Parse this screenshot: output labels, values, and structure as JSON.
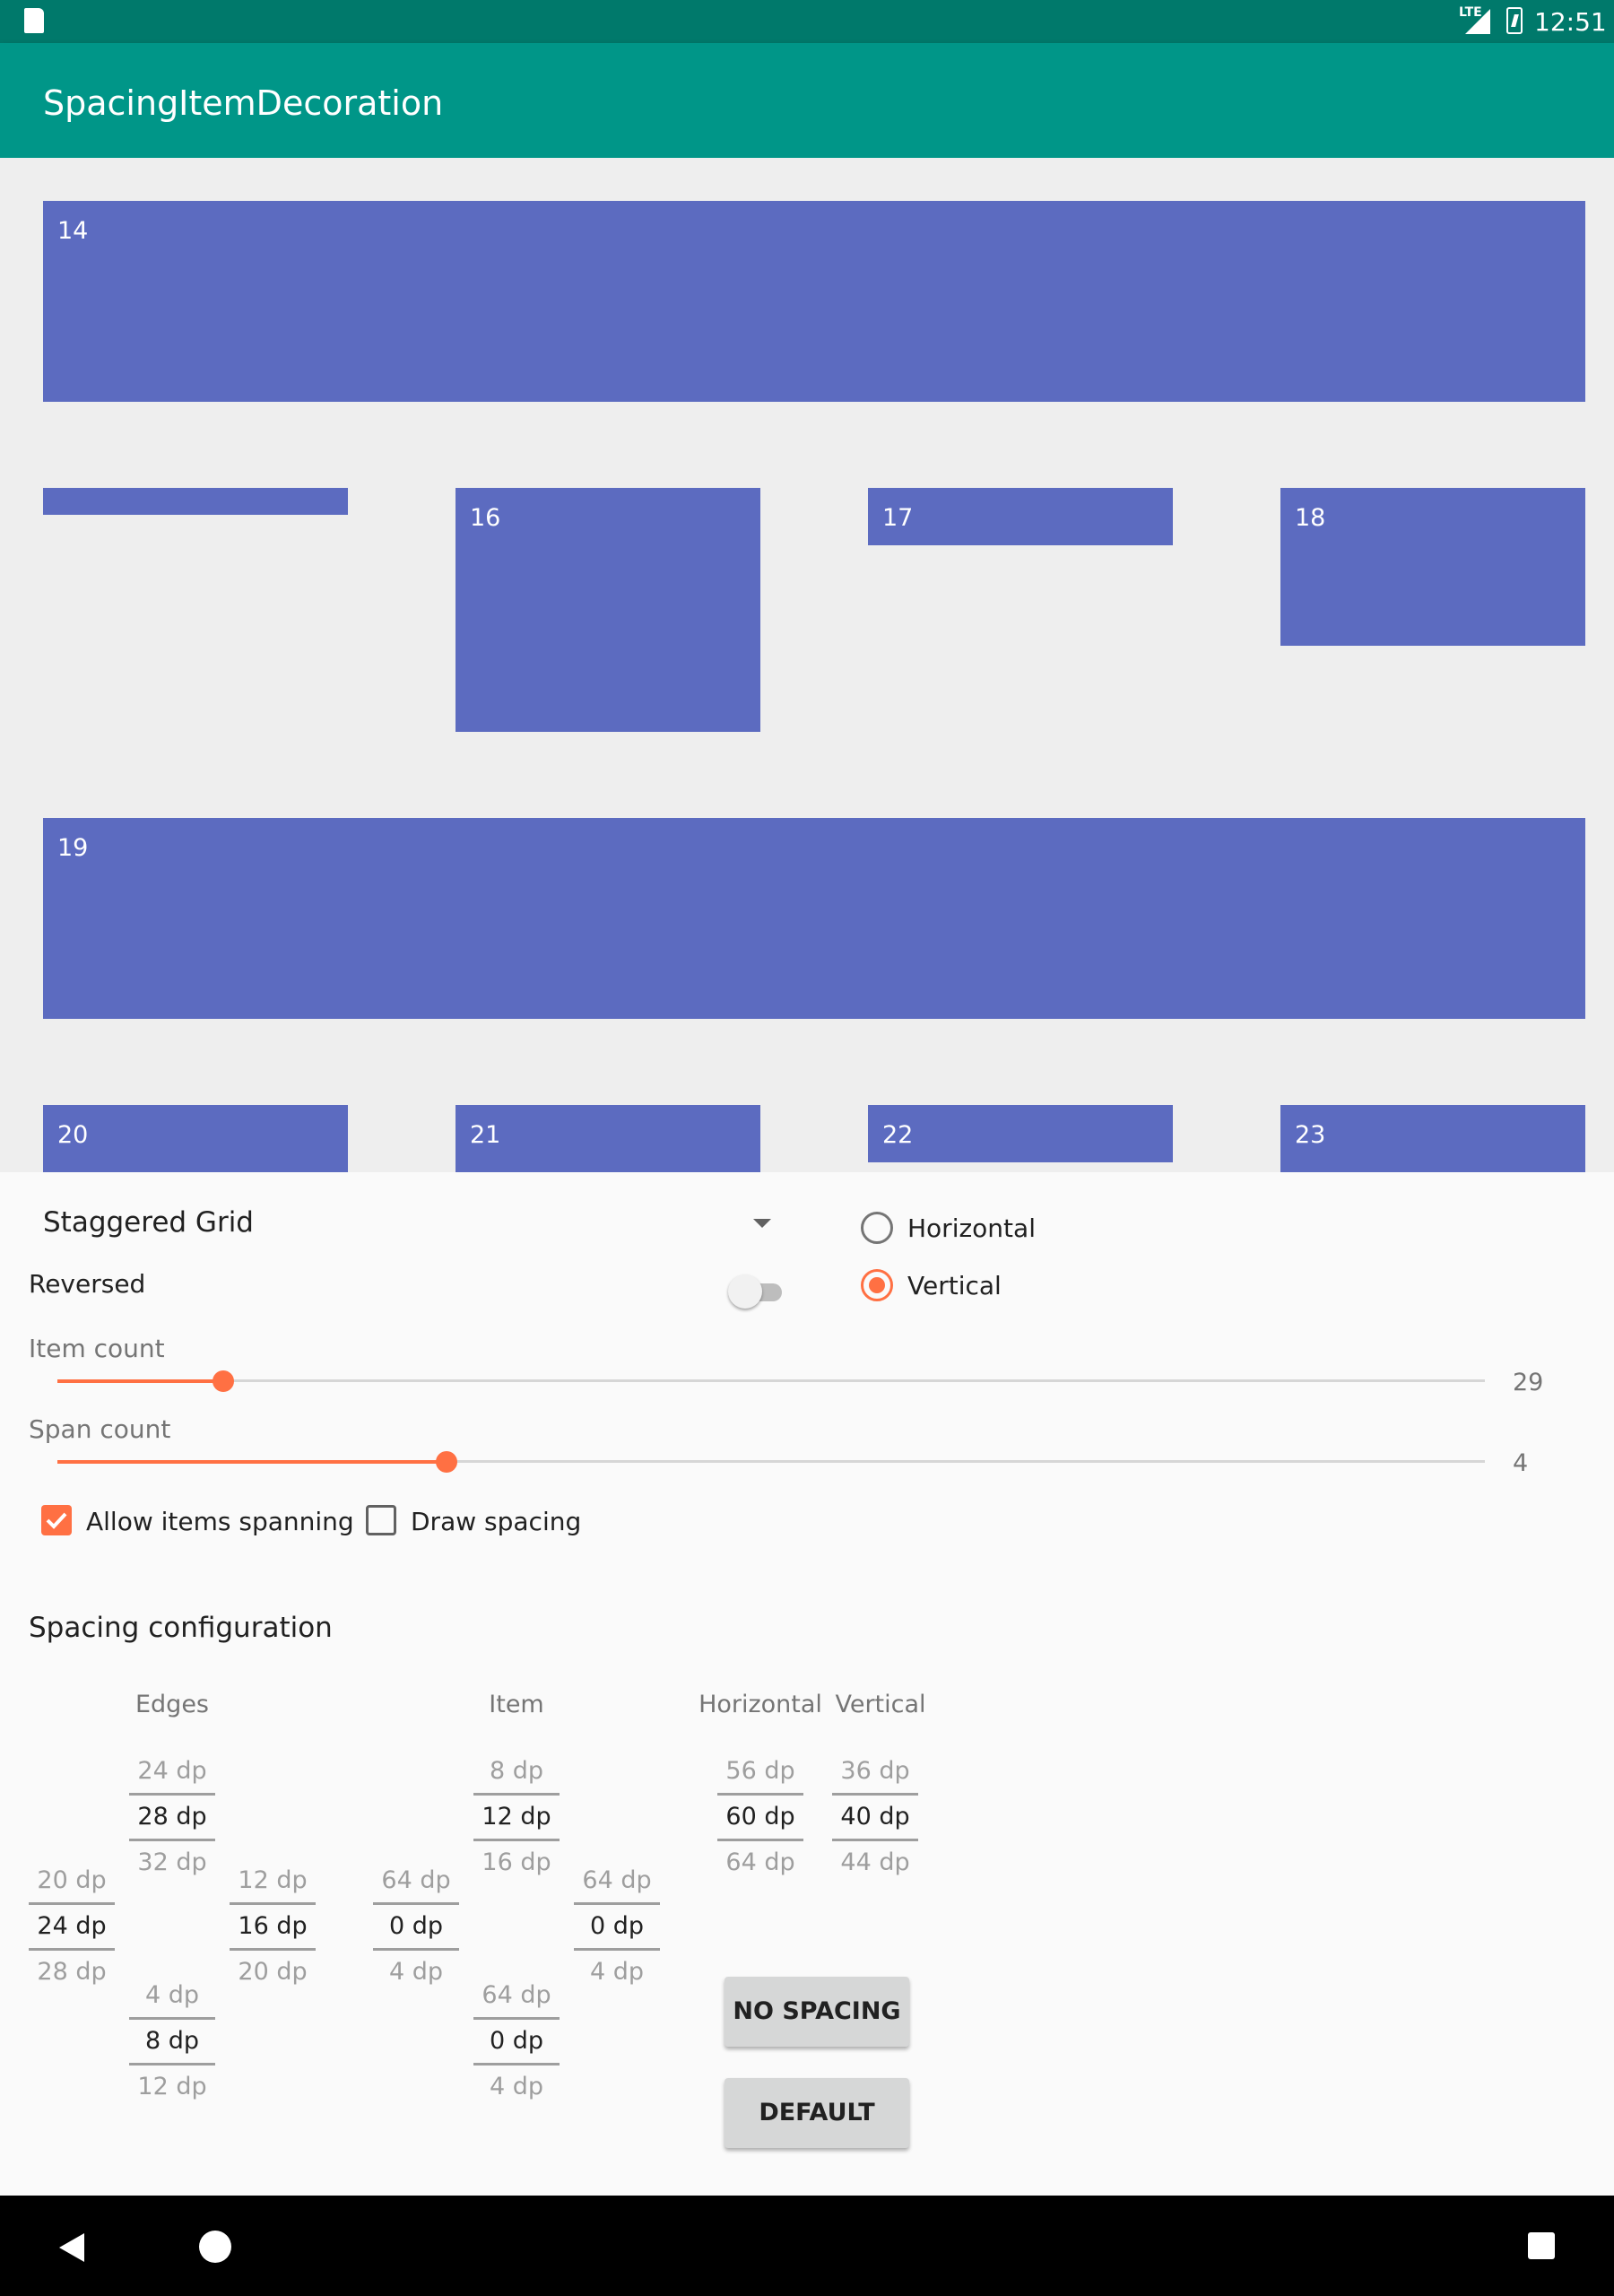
{
  "status_bar": {
    "network": "LTE",
    "time": "12:51"
  },
  "app_bar": {
    "title": "SpacingItemDecoration"
  },
  "grid_items": [
    "14",
    "16",
    "17",
    "18",
    "19",
    "20",
    "21",
    "22",
    "23"
  ],
  "controls": {
    "layout_select": "Staggered Grid",
    "reversed_label": "Reversed",
    "orientation": {
      "horizontal_label": "Horizontal",
      "vertical_label": "Vertical",
      "selected": "Vertical"
    },
    "item_count": {
      "label": "Item count",
      "value": "29",
      "fraction": 0.116
    },
    "span_count": {
      "label": "Span count",
      "value": "4",
      "fraction": 0.272
    },
    "allow_spanning": {
      "label": "Allow items spanning",
      "checked": true
    },
    "draw_spacing": {
      "label": "Draw spacing",
      "checked": false
    }
  },
  "spacing": {
    "title": "Spacing configuration",
    "headers": {
      "edges": "Edges",
      "item": "Item",
      "horizontal": "Horizontal",
      "vertical": "Vertical"
    },
    "edges": {
      "top": {
        "prev": "24 dp",
        "cur": "28 dp",
        "next": "32 dp"
      },
      "left": {
        "prev": "20 dp",
        "cur": "24 dp",
        "next": "28 dp"
      },
      "right": {
        "prev": "12 dp",
        "cur": "16 dp",
        "next": "20 dp"
      },
      "bottom": {
        "prev": "4 dp",
        "cur": "8 dp",
        "next": "12 dp"
      }
    },
    "item": {
      "top": {
        "prev": "8 dp",
        "cur": "12 dp",
        "next": "16 dp"
      },
      "left": {
        "prev": "64 dp",
        "cur": "0 dp",
        "next": "4 dp"
      },
      "right": {
        "prev": "64 dp",
        "cur": "0 dp",
        "next": "4 dp"
      },
      "bottom": {
        "prev": "64 dp",
        "cur": "0 dp",
        "next": "4 dp"
      }
    },
    "horizontal": {
      "prev": "56 dp",
      "cur": "60 dp",
      "next": "64 dp"
    },
    "vertical": {
      "prev": "36 dp",
      "cur": "40 dp",
      "next": "44 dp"
    },
    "no_spacing_button": "NO SPACING",
    "default_button": "DEFAULT"
  },
  "colors": {
    "primary": "#009688",
    "primary_dark": "#00796b",
    "accent": "#ff7043",
    "card": "#5c6bc0"
  }
}
